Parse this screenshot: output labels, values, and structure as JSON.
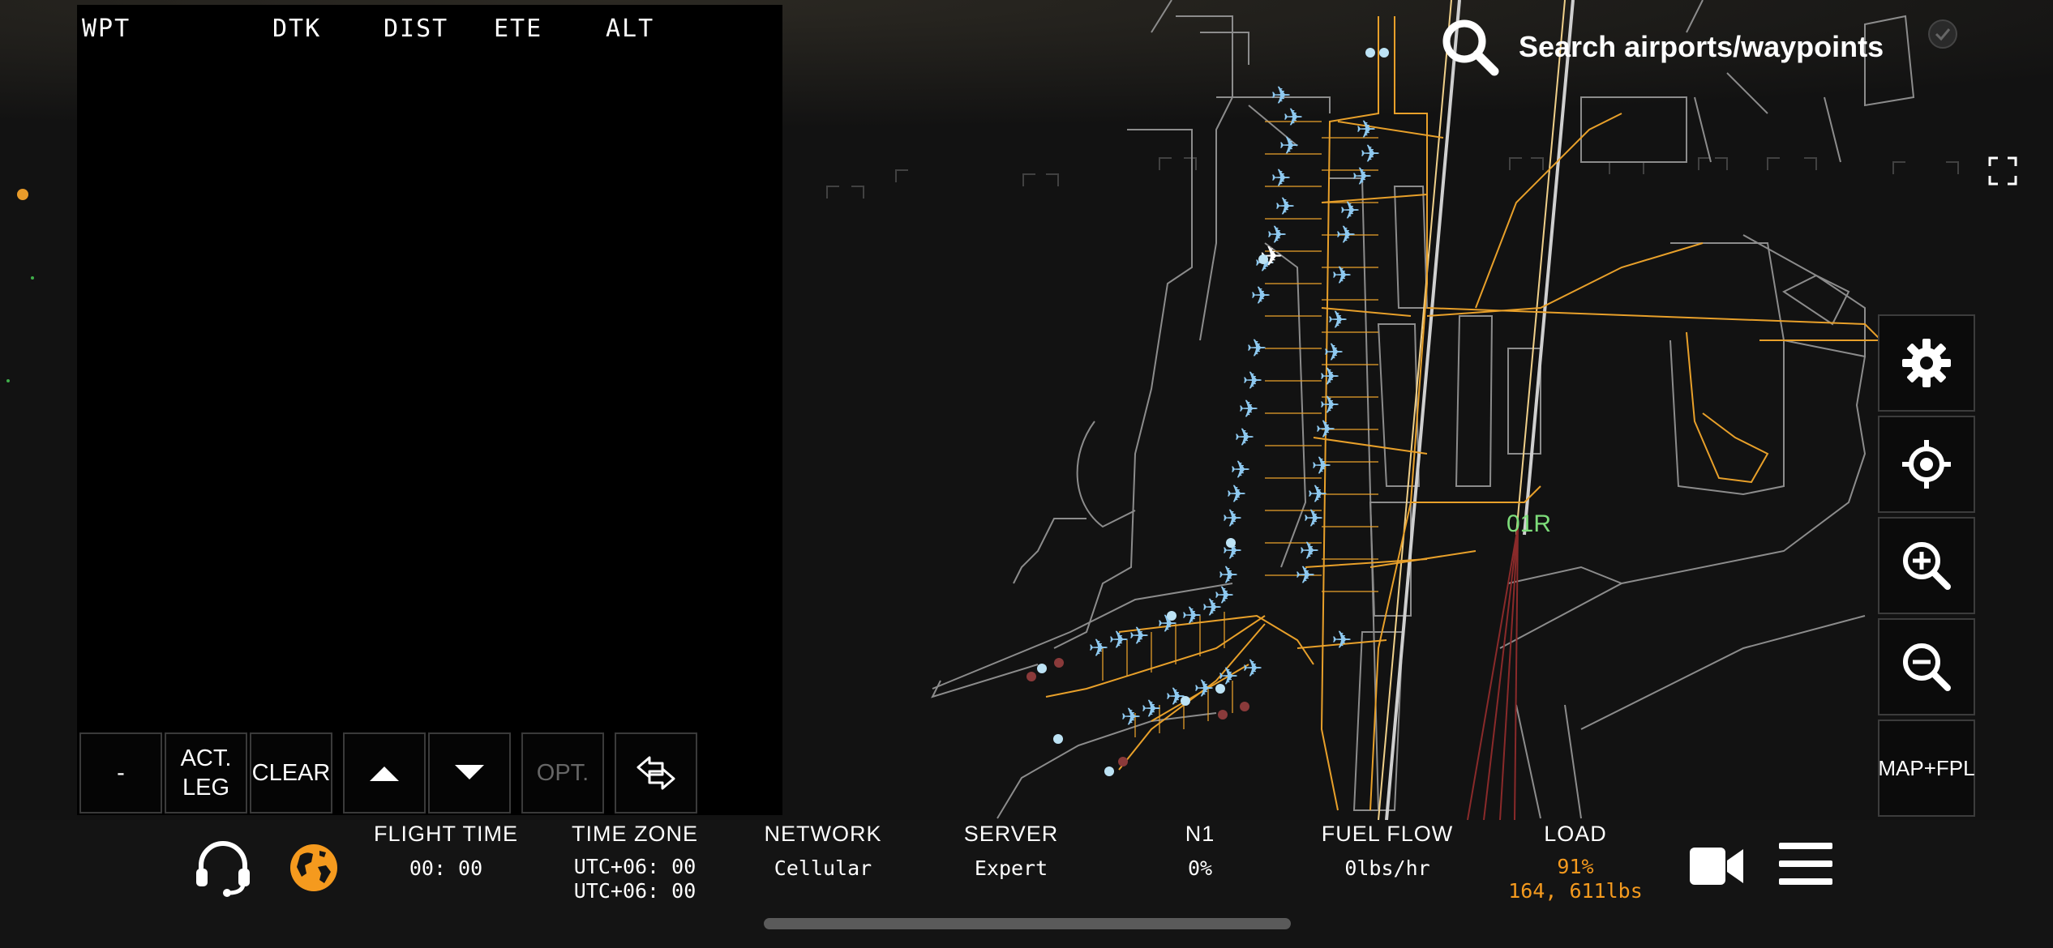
{
  "flight_plan": {
    "columns": [
      "WPT",
      "DTK",
      "DIST",
      "ETE",
      "ALT"
    ],
    "buttons": {
      "remove": "-",
      "activate_leg": "ACT.\nLEG",
      "clear": "CLEAR",
      "move_up": "up-arrow-icon",
      "move_down": "down-arrow-icon",
      "options": "OPT.",
      "swap": "swap-direction-icon"
    }
  },
  "search": {
    "label": "Search airports/waypoints",
    "icon": "search-icon"
  },
  "map": {
    "runway_label": "01R",
    "runway_label_color": "#7ddc7a",
    "taxiway_color": "#e8a02a",
    "terminal_outline_color": "#9a9a9a",
    "aircraft_color": "#8ec9f0"
  },
  "tools": {
    "settings": "gear-icon",
    "center": "crosshair-icon",
    "zoom_in": "zoom-in-icon",
    "zoom_out": "zoom-out-icon",
    "map_fpl_label": "MAP+FPL",
    "fullscreen": "fullscreen-icon"
  },
  "status_bar": {
    "flight_time": {
      "label": "FLIGHT TIME",
      "value": "00: 00"
    },
    "time_zone": {
      "label": "TIME ZONE",
      "value_1": "UTC+06: 00",
      "value_2": "UTC+06: 00"
    },
    "network": {
      "label": "NETWORK",
      "value": "Cellular"
    },
    "server": {
      "label": "SERVER",
      "value": "Expert"
    },
    "n1": {
      "label": "N1",
      "value": "0%"
    },
    "fuel_flow": {
      "label": "FUEL FLOW",
      "value": "0lbs/hr"
    },
    "load": {
      "label": "LOAD",
      "value_percent": "91%",
      "value_weight": "164, 611lbs",
      "color": "#f59a1e"
    },
    "icons": [
      "headset-icon",
      "globe-icon",
      "camera-icon",
      "menu-icon"
    ],
    "globe_color": "#f59a1e"
  }
}
